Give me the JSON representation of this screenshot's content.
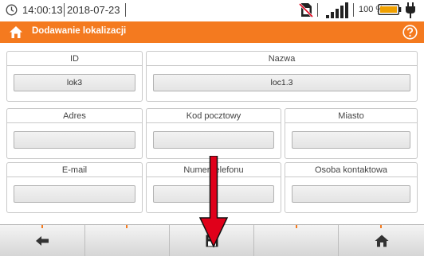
{
  "status": {
    "time": "14:00:13",
    "date": "2018-07-23",
    "battery_percent": "100 %"
  },
  "header": {
    "title": "Dodawanie lokalizacji"
  },
  "form": {
    "id": {
      "label": "ID",
      "value": "lok3"
    },
    "nazwa": {
      "label": "Nazwa",
      "value": "loc1.3"
    },
    "adres": {
      "label": "Adres",
      "value": ""
    },
    "kod": {
      "label": "Kod pocztowy",
      "value": ""
    },
    "miasto": {
      "label": "Miasto",
      "value": ""
    },
    "email": {
      "label": "E-mail",
      "value": ""
    },
    "telefon": {
      "label": "Numer telefonu",
      "value": ""
    },
    "osoba": {
      "label": "Osoba kontaktowa",
      "value": ""
    }
  },
  "colors": {
    "accent": "#f47a1f",
    "annotation": "#e0001a"
  },
  "icons": {
    "back": "arrow-left-icon",
    "save": "floppy-disk-icon",
    "home": "home-icon"
  }
}
